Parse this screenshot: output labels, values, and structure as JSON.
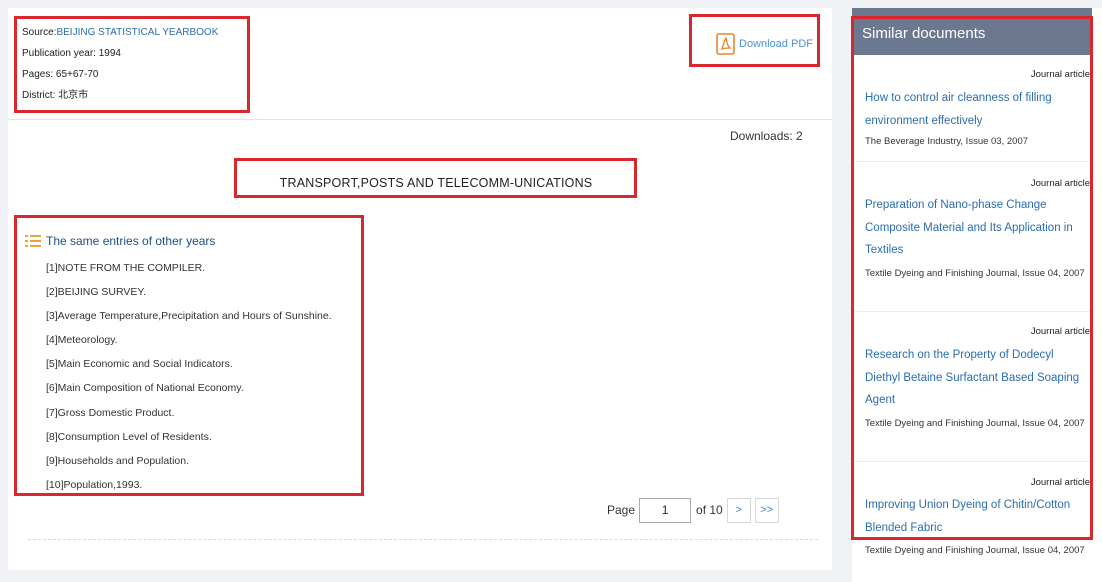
{
  "meta": {
    "source_label": "Source:",
    "source_value": "BEIJING STATISTICAL YEARBOOK",
    "publication_year": "Publication year: 1994",
    "pages": "Pages:  65+67-70",
    "district": "District: 北京市"
  },
  "download_pdf": {
    "label": "Download PDF",
    "icon": "pdf-icon"
  },
  "downloads": "Downloads: 2",
  "document_title": "TRANSPORT,POSTS AND TELECOMM-UNICATIONS",
  "same_entries": {
    "heading": "The same entries of other years",
    "icon": "list-icon",
    "items": [
      "[1]NOTE FROM THE COMPILER.",
      "[2]BEIJING SURVEY.",
      "[3]Average Temperature,Precipitation and Hours of Sunshine.",
      "[4]Meteorology.",
      "[5]Main Economic and Social Indicators.",
      "[6]Main Composition of National Economy.",
      "[7]Gross Domestic Product.",
      "[8]Consumption Level of Residents.",
      "[9]Households and Population.",
      "[10]Population,1993."
    ]
  },
  "pagination": {
    "page_label": "Page",
    "current_page": "1",
    "of_label": "of 10",
    "next": ">",
    "last": ">>"
  },
  "similar": {
    "heading": "Similar documents",
    "docs": [
      {
        "type": "Journal article",
        "title": "How to control air cleanness of filling environment effectively",
        "source": "The Beverage Industry, Issue 03, 2007"
      },
      {
        "type": "Journal article",
        "title": "Preparation of Nano-phase Change Composite Material and Its Application in Textiles",
        "source": "Textile Dyeing and Finishing Journal, Issue 04, 2007"
      },
      {
        "type": "Journal article",
        "title": "Research on the Property of Dodecyl Diethyl Betaine Surfactant Based Soaping Agent",
        "source": "Textile Dyeing and Finishing Journal, Issue 04, 2007"
      },
      {
        "type": "Journal article",
        "title": "Improving Union Dyeing of Chitin/Cotton Blended Fabric",
        "source": "Textile Dyeing and Finishing Journal, Issue 04, 2007"
      }
    ]
  },
  "colors": {
    "highlight_box": "#d9272e",
    "link": "#2a6db0",
    "sidebar_header": "#6b7890",
    "pdf_icon": "#e8832a"
  }
}
